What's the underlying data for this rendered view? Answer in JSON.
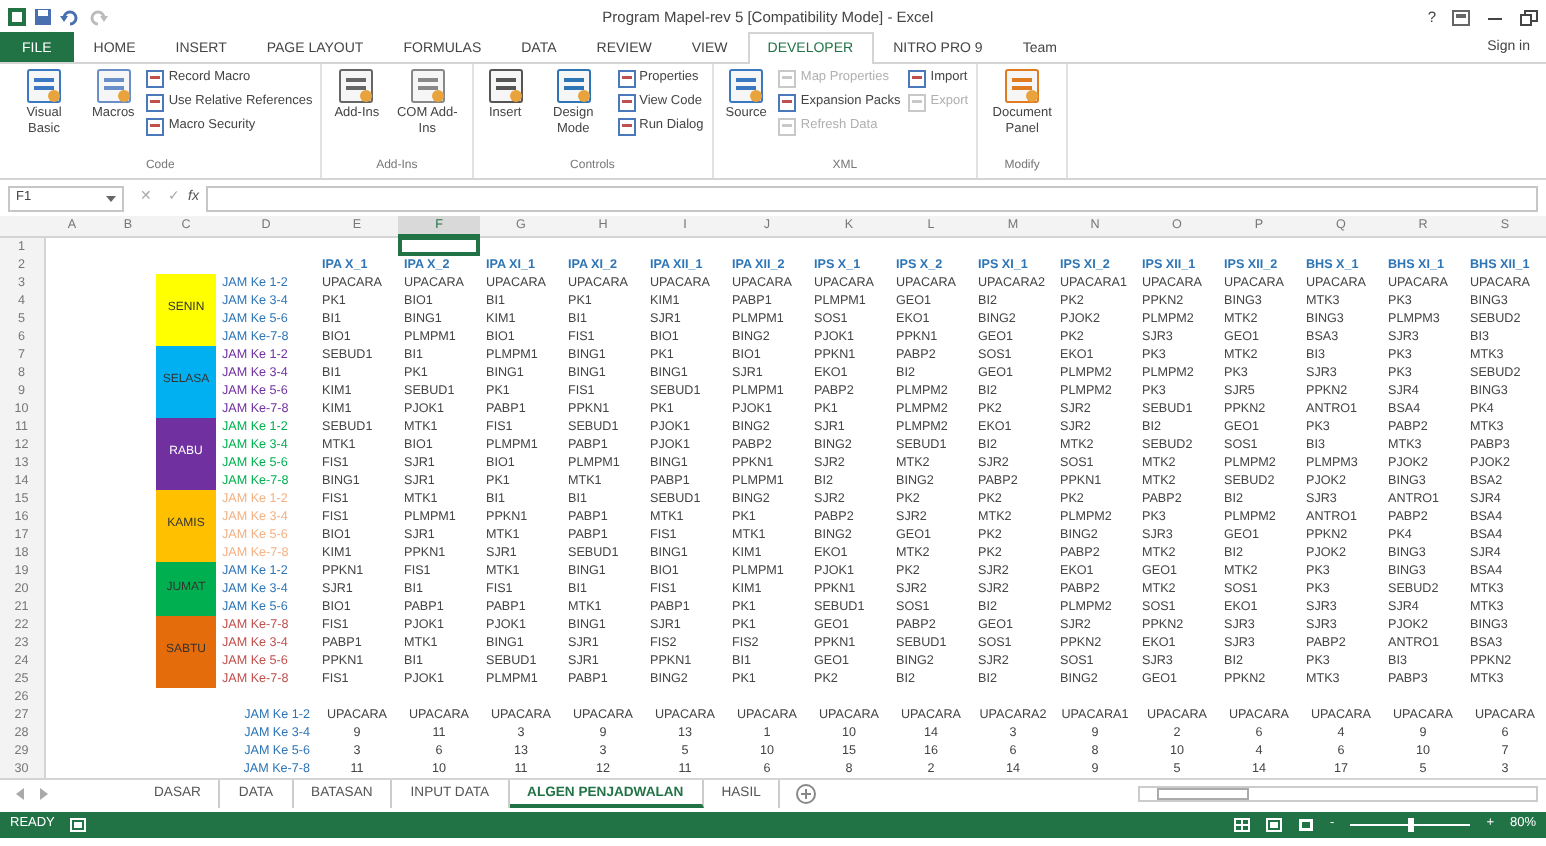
{
  "window": {
    "title": "Program Mapel-rev 5  [Compatibility Mode] - Excel",
    "help": "?"
  },
  "tabs": [
    {
      "label": "FILE",
      "selected": false,
      "kind": "file"
    },
    {
      "label": "HOME",
      "selected": false,
      "kind": "tab"
    },
    {
      "label": "INSERT",
      "selected": false,
      "kind": "tab"
    },
    {
      "label": "PAGE LAYOUT",
      "selected": false,
      "kind": "tab"
    },
    {
      "label": "FORMULAS",
      "selected": false,
      "kind": "tab"
    },
    {
      "label": "DATA",
      "selected": false,
      "kind": "tab"
    },
    {
      "label": "REVIEW",
      "selected": false,
      "kind": "tab"
    },
    {
      "label": "VIEW",
      "selected": false,
      "kind": "tab"
    },
    {
      "label": "DEVELOPER",
      "selected": true,
      "kind": "tab"
    },
    {
      "label": "NITRO PRO 9",
      "selected": false,
      "kind": "tab"
    },
    {
      "label": "Team",
      "selected": false,
      "kind": "tab"
    }
  ],
  "account": "Sign in",
  "ribbon": [
    {
      "label": "Code",
      "items": [
        {
          "label": "Visual Basic",
          "kind": "large",
          "disabled": false
        },
        {
          "label": "Macros",
          "kind": "large",
          "disabled": false
        },
        {
          "kind": "stack",
          "items": [
            {
              "label": "Record Macro",
              "disabled": false
            },
            {
              "label": "Use Relative References",
              "disabled": false
            },
            {
              "label": "Macro Security",
              "disabled": false
            }
          ]
        }
      ]
    },
    {
      "label": "Add-Ins",
      "items": [
        {
          "label": "Add-Ins",
          "kind": "large",
          "disabled": false
        },
        {
          "label": "COM Add-Ins",
          "kind": "large",
          "disabled": false
        }
      ]
    },
    {
      "label": "Controls",
      "items": [
        {
          "label": "Insert",
          "kind": "large",
          "disabled": false
        },
        {
          "label": "Design Mode",
          "kind": "large",
          "disabled": false
        },
        {
          "kind": "stack",
          "items": [
            {
              "label": "Properties",
              "disabled": false
            },
            {
              "label": "View Code",
              "disabled": false
            },
            {
              "label": "Run Dialog",
              "disabled": false
            }
          ]
        }
      ]
    },
    {
      "label": "XML",
      "items": [
        {
          "label": "Source",
          "kind": "large",
          "disabled": false
        },
        {
          "kind": "stack",
          "items": [
            {
              "label": "Map Properties",
              "disabled": true
            },
            {
              "label": "Expansion Packs",
              "disabled": false
            },
            {
              "label": "Refresh Data",
              "disabled": true
            }
          ]
        },
        {
          "kind": "stack",
          "items": [
            {
              "label": "Import",
              "disabled": false
            },
            {
              "label": "Export",
              "disabled": true
            }
          ]
        }
      ]
    },
    {
      "label": "Modify",
      "items": [
        {
          "label": "Document Panel",
          "kind": "large",
          "disabled": false
        }
      ]
    }
  ],
  "name_box": "F1",
  "formula_bar": {
    "cancel": "✕",
    "enter": "✓",
    "function": "fx"
  },
  "column_headers": [
    {
      "label": "A",
      "selected": false
    },
    {
      "label": "B",
      "selected": false
    },
    {
      "label": "C",
      "selected": false
    },
    {
      "label": "D",
      "selected": false
    },
    {
      "label": "E",
      "selected": false
    },
    {
      "label": "F",
      "selected": true
    },
    {
      "label": "G",
      "selected": false
    },
    {
      "label": "H",
      "selected": false
    },
    {
      "label": "I",
      "selected": false
    },
    {
      "label": "J",
      "selected": false
    },
    {
      "label": "K",
      "selected": false
    },
    {
      "label": "L",
      "selected": false
    },
    {
      "label": "M",
      "selected": false
    },
    {
      "label": "N",
      "selected": false
    },
    {
      "label": "O",
      "selected": false
    },
    {
      "label": "P",
      "selected": false
    },
    {
      "label": "Q",
      "selected": false
    },
    {
      "label": "R",
      "selected": false
    },
    {
      "label": "S",
      "selected": false
    }
  ],
  "row_headers": [
    "1",
    "2",
    "3",
    "4",
    "5",
    "6",
    "7",
    "8",
    "9",
    "10",
    "11",
    "12",
    "13",
    "14",
    "15",
    "16",
    "17",
    "18",
    "19",
    "20",
    "21",
    "22",
    "23",
    "24",
    "25",
    "26",
    "27",
    "28",
    "29",
    "30"
  ],
  "class_headers": [
    "IPA X_1",
    "IPA X_2",
    "IPA XI_1",
    "IPA XI_2",
    "IPA XII_1",
    "IPA XII_2",
    "IPS X_1",
    "IPS X_2",
    "IPS XI_1",
    "IPS XI_2",
    "IPS XII_1",
    "IPS XII_2",
    "BHS X_1",
    "BHS XI_1",
    "BHS XII_1"
  ],
  "days": [
    {
      "name": "SENIN",
      "color": "#ffff00",
      "slots": [
        {
          "label": "JAM Ke 1-2",
          "color": "#2e75b6",
          "cells": [
            "UPACARA",
            "UPACARA",
            "UPACARA",
            "UPACARA",
            "UPACARA",
            "UPACARA",
            "UPACARA",
            "UPACARA",
            "UPACARA2",
            "UPACARA1",
            "UPACARA",
            "UPACARA",
            "UPACARA",
            "UPACARA",
            "UPACARA"
          ]
        },
        {
          "label": "JAM Ke 3-4",
          "color": "#2e75b6",
          "cells": [
            "PK1",
            "BIO1",
            "BI1",
            "PK1",
            "KIM1",
            "PABP1",
            "PLMPM1",
            "GEO1",
            "BI2",
            "PK2",
            "PPKN2",
            "BING3",
            "MTK3",
            "PK3",
            "BING3"
          ]
        },
        {
          "label": "JAM Ke 5-6",
          "color": "#2e75b6",
          "cells": [
            "BI1",
            "BING1",
            "KIM1",
            "BI1",
            "SJR1",
            "PLMPM1",
            "SOS1",
            "EKO1",
            "BING2",
            "PJOK2",
            "PLMPM2",
            "MTK2",
            "BING3",
            "PLMPM3",
            "SEBUD2"
          ]
        },
        {
          "label": "JAM Ke-7-8",
          "color": "#2e75b6",
          "cells": [
            "BIO1",
            "PLMPM1",
            "BIO1",
            "FIS1",
            "BIO1",
            "BING2",
            "PJOK1",
            "PPKN1",
            "GEO1",
            "PK2",
            "SJR3",
            "GEO1",
            "BSA3",
            "SJR3",
            "BI3"
          ]
        }
      ]
    },
    {
      "name": "SELASA",
      "color": "#00b0f0",
      "slots": [
        {
          "label": "JAM Ke 1-2",
          "color": "#7030a0",
          "cells": [
            "SEBUD1",
            "BI1",
            "PLMPM1",
            "BING1",
            "PK1",
            "BIO1",
            "PPKN1",
            "PABP2",
            "SOS1",
            "EKO1",
            "PK3",
            "MTK2",
            "BI3",
            "PK3",
            "MTK3"
          ]
        },
        {
          "label": "JAM Ke 3-4",
          "color": "#7030a0",
          "cells": [
            "BI1",
            "PK1",
            "BING1",
            "BING1",
            "BING1",
            "SJR1",
            "EKO1",
            "BI2",
            "GEO1",
            "PLMPM2",
            "PLMPM2",
            "PK3",
            "SJR3",
            "PK3",
            "SEBUD2"
          ]
        },
        {
          "label": "JAM Ke 5-6",
          "color": "#7030a0",
          "cells": [
            "KIM1",
            "SEBUD1",
            "PK1",
            "FIS1",
            "SEBUD1",
            "PLMPM1",
            "PABP2",
            "PLMPM2",
            "BI2",
            "PLMPM2",
            "PK3",
            "SJR5",
            "PPKN2",
            "SJR4",
            "BING3"
          ]
        },
        {
          "label": "JAM Ke-7-8",
          "color": "#7030a0",
          "cells": [
            "KIM1",
            "PJOK1",
            "PABP1",
            "PPKN1",
            "PK1",
            "PJOK1",
            "PK1",
            "PLMPM2",
            "PK2",
            "SJR2",
            "SEBUD1",
            "PPKN2",
            "ANTRO1",
            "BSA4",
            "PK4"
          ]
        }
      ]
    },
    {
      "name": "RABU",
      "color": "#7030a0",
      "slots": [
        {
          "label": "JAM Ke 1-2",
          "color": "#00b050",
          "cells": [
            "SEBUD1",
            "MTK1",
            "FIS1",
            "SEBUD1",
            "PJOK1",
            "BING2",
            "SJR1",
            "PLMPM2",
            "EKO1",
            "SJR2",
            "BI2",
            "GEO1",
            "PK3",
            "PABP2",
            "MTK3"
          ]
        },
        {
          "label": "JAM Ke 3-4",
          "color": "#00b050",
          "cells": [
            "MTK1",
            "BIO1",
            "PLMPM1",
            "PABP1",
            "PJOK1",
            "PABP2",
            "BING2",
            "SEBUD1",
            "BI2",
            "MTK2",
            "SEBUD2",
            "SOS1",
            "BI3",
            "MTK3",
            "PABP3"
          ]
        },
        {
          "label": "JAM Ke 5-6",
          "color": "#00b050",
          "cells": [
            "FIS1",
            "SJR1",
            "BIO1",
            "PLMPM1",
            "BING1",
            "PPKN1",
            "SJR2",
            "MTK2",
            "SJR2",
            "SOS1",
            "MTK2",
            "PLMPM2",
            "PLMPM3",
            "PJOK2",
            "PJOK2"
          ]
        },
        {
          "label": "JAM Ke-7-8",
          "color": "#00b050",
          "cells": [
            "BING1",
            "SJR1",
            "PK1",
            "MTK1",
            "PABP1",
            "PLMPM1",
            "BI2",
            "BING2",
            "PABP2",
            "PPKN1",
            "MTK2",
            "SEBUD2",
            "PJOK2",
            "BING3",
            "BSA2"
          ]
        }
      ]
    },
    {
      "name": "KAMIS",
      "color": "#ffc000",
      "slots": [
        {
          "label": "JAM Ke 1-2",
          "color": "#f4b183",
          "cells": [
            "FIS1",
            "MTK1",
            "BI1",
            "BI1",
            "SEBUD1",
            "BING2",
            "SJR2",
            "PK2",
            "PK2",
            "PK2",
            "PABP2",
            "BI2",
            "SJR3",
            "ANTRO1",
            "SJR4"
          ]
        },
        {
          "label": "JAM Ke 3-4",
          "color": "#f4b183",
          "cells": [
            "FIS1",
            "PLMPM1",
            "PPKN1",
            "PABP1",
            "MTK1",
            "PK1",
            "PABP2",
            "SJR2",
            "MTK2",
            "PLMPM2",
            "PK3",
            "PLMPM2",
            "ANTRO1",
            "PABP2",
            "BSA4"
          ]
        },
        {
          "label": "JAM Ke 5-6",
          "color": "#f4b183",
          "cells": [
            "BIO1",
            "SJR1",
            "MTK1",
            "PABP1",
            "FIS1",
            "MTK1",
            "BING2",
            "GEO1",
            "PK2",
            "BING2",
            "SJR3",
            "GEO1",
            "PPKN2",
            "PK4",
            "BSA4"
          ]
        },
        {
          "label": "JAM Ke-7-8",
          "color": "#f4b183",
          "cells": [
            "KIM1",
            "PPKN1",
            "SJR1",
            "SEBUD1",
            "BING1",
            "KIM1",
            "EKO1",
            "MTK2",
            "PK2",
            "PABP2",
            "MTK2",
            "BI2",
            "PJOK2",
            "BING3",
            "SJR4"
          ]
        }
      ]
    },
    {
      "name": "JUMAT",
      "color": "#00b050",
      "slots": [
        {
          "label": "JAM Ke 1-2",
          "color": "#2e75b6",
          "cells": [
            "PPKN1",
            "FIS1",
            "MTK1",
            "BING1",
            "BIO1",
            "PLMPM1",
            "PJOK1",
            "PK2",
            "SJR2",
            "EKO1",
            "GEO1",
            "MTK2",
            "PK3",
            "BING3",
            "BSA4"
          ]
        },
        {
          "label": "JAM Ke 3-4",
          "color": "#2e75b6",
          "cells": [
            "SJR1",
            "BI1",
            "FIS1",
            "BI1",
            "FIS1",
            "KIM1",
            "PPKN1",
            "SJR2",
            "SJR2",
            "PABP2",
            "MTK2",
            "SOS1",
            "PK3",
            "SEBUD2",
            "MTK3"
          ]
        },
        {
          "label": "JAM Ke 5-6",
          "color": "#2e75b6",
          "cells": [
            "BIO1",
            "PABP1",
            "PABP1",
            "MTK1",
            "PABP1",
            "PK1",
            "SEBUD1",
            "SOS1",
            "BI2",
            "PLMPM2",
            "SOS1",
            "EKO1",
            "SJR3",
            "SJR4",
            "MTK3"
          ]
        }
      ]
    },
    {
      "name": "SABTU",
      "color": "#e46c0a",
      "slots": [
        {
          "label": "JAM Ke-7-8",
          "color": "#c0504d",
          "cells": [
            "FIS1",
            "PJOK1",
            "PJOK1",
            "BING1",
            "SJR1",
            "PK1",
            "GEO1",
            "PABP2",
            "GEO1",
            "SJR2",
            "PPKN2",
            "SJR3",
            "SJR3",
            "PJOK2",
            "BING3"
          ]
        },
        {
          "label": "JAM Ke 3-4",
          "color": "#c0504d",
          "cells": [
            "PABP1",
            "MTK1",
            "BING1",
            "SJR1",
            "FIS2",
            "FIS2",
            "PPKN1",
            "SEBUD1",
            "SOS1",
            "PPKN2",
            "EKO1",
            "SJR3",
            "PABP2",
            "ANTRO1",
            "BSA3"
          ]
        },
        {
          "label": "JAM Ke 5-6",
          "color": "#c0504d",
          "cells": [
            "PPKN1",
            "BI1",
            "SEBUD1",
            "SJR1",
            "PPKN1",
            "BI1",
            "GEO1",
            "BING2",
            "SJR2",
            "SOS1",
            "SJR3",
            "BI2",
            "PK3",
            "BI3",
            "PPKN2"
          ]
        },
        {
          "label": "JAM Ke-7-8",
          "color": "#c0504d",
          "cells": [
            "FIS1",
            "PJOK1",
            "PLMPM1",
            "PABP1",
            "BING2",
            "PK1",
            "PK2",
            "BI2",
            "BI2",
            "BING2",
            "GEO1",
            "PPKN2",
            "MTK3",
            "PABP3",
            "MTK3"
          ]
        }
      ]
    }
  ],
  "summary": [
    {
      "label": "JAM Ke 1-2",
      "cells": [
        "UPACARA",
        "UPACARA",
        "UPACARA",
        "UPACARA",
        "UPACARA",
        "UPACARA",
        "UPACARA",
        "UPACARA",
        "UPACARA2",
        "UPACARA1",
        "UPACARA",
        "UPACARA",
        "UPACARA",
        "UPACARA",
        "UPACARA"
      ]
    },
    {
      "label": "JAM Ke 3-4",
      "cells": [
        "9",
        "11",
        "3",
        "9",
        "13",
        "1",
        "10",
        "14",
        "3",
        "9",
        "2",
        "6",
        "4",
        "9",
        "6"
      ]
    },
    {
      "label": "JAM Ke 5-6",
      "cells": [
        "3",
        "6",
        "13",
        "3",
        "5",
        "10",
        "15",
        "16",
        "6",
        "8",
        "10",
        "4",
        "6",
        "10",
        "7"
      ]
    },
    {
      "label": "JAM Ke-7-8",
      "cells": [
        "11",
        "10",
        "11",
        "12",
        "11",
        "6",
        "8",
        "2",
        "14",
        "9",
        "5",
        "14",
        "17",
        "5",
        "3"
      ]
    }
  ],
  "sheet_tabs": [
    {
      "label": "DASAR",
      "selected": false
    },
    {
      "label": "DATA",
      "selected": false
    },
    {
      "label": "BATASAN",
      "selected": false
    },
    {
      "label": "INPUT DATA",
      "selected": false
    },
    {
      "label": "ALGEN PENJADWALAN",
      "selected": true
    },
    {
      "label": "HASIL",
      "selected": false
    }
  ],
  "status": {
    "text": "READY",
    "zoom": {
      "out": "-",
      "level": 0.5,
      "in": "+",
      "reading": "80%"
    }
  }
}
